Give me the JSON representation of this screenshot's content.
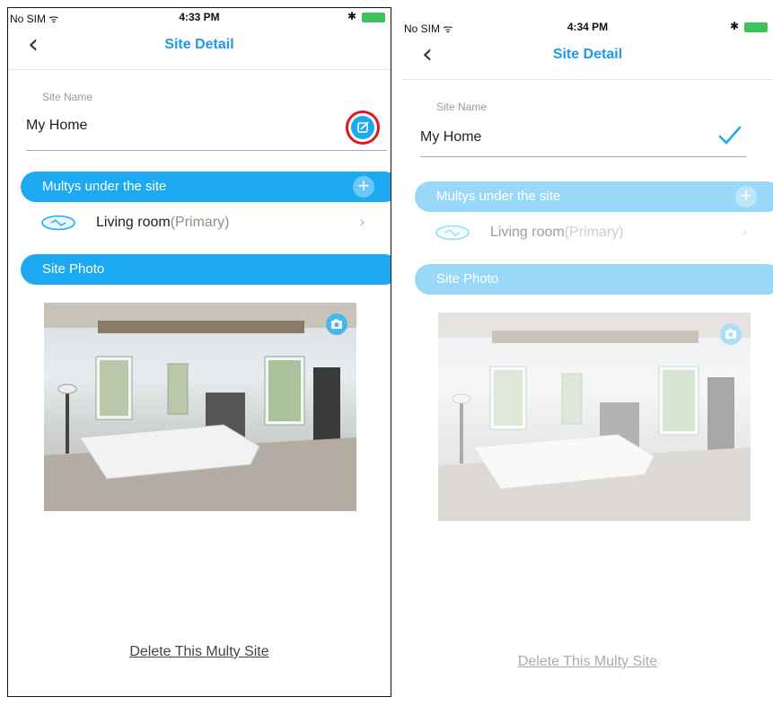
{
  "screens": [
    {
      "status": {
        "carrier": "No SIM ᯤ",
        "time": "4:33 PM",
        "bt": "✱"
      },
      "nav": {
        "title": "Site Detail"
      },
      "site_name_label": "Site Name",
      "site_name_value": "My Home",
      "multys_header": "Multys under the site",
      "device": {
        "name": "Living room",
        "tag": "(Primary)"
      },
      "photo_header": "Site Photo",
      "delete_label": "Delete This Multy Site"
    },
    {
      "status": {
        "carrier": "No SIM ᯤ",
        "time": "4:34 PM",
        "bt": "✱"
      },
      "nav": {
        "title": "Site Detail"
      },
      "site_name_label": "Site Name",
      "site_name_value": "My Home",
      "multys_header": "Multys under the site",
      "device": {
        "name": "Living room",
        "tag": "(Primary)"
      },
      "photo_header": "Site Photo",
      "delete_label": "Delete This Multy Site"
    }
  ],
  "colors": {
    "accent": "#1ca9f2",
    "title": "#1e9be8",
    "highlight_ring": "#e5161b"
  }
}
